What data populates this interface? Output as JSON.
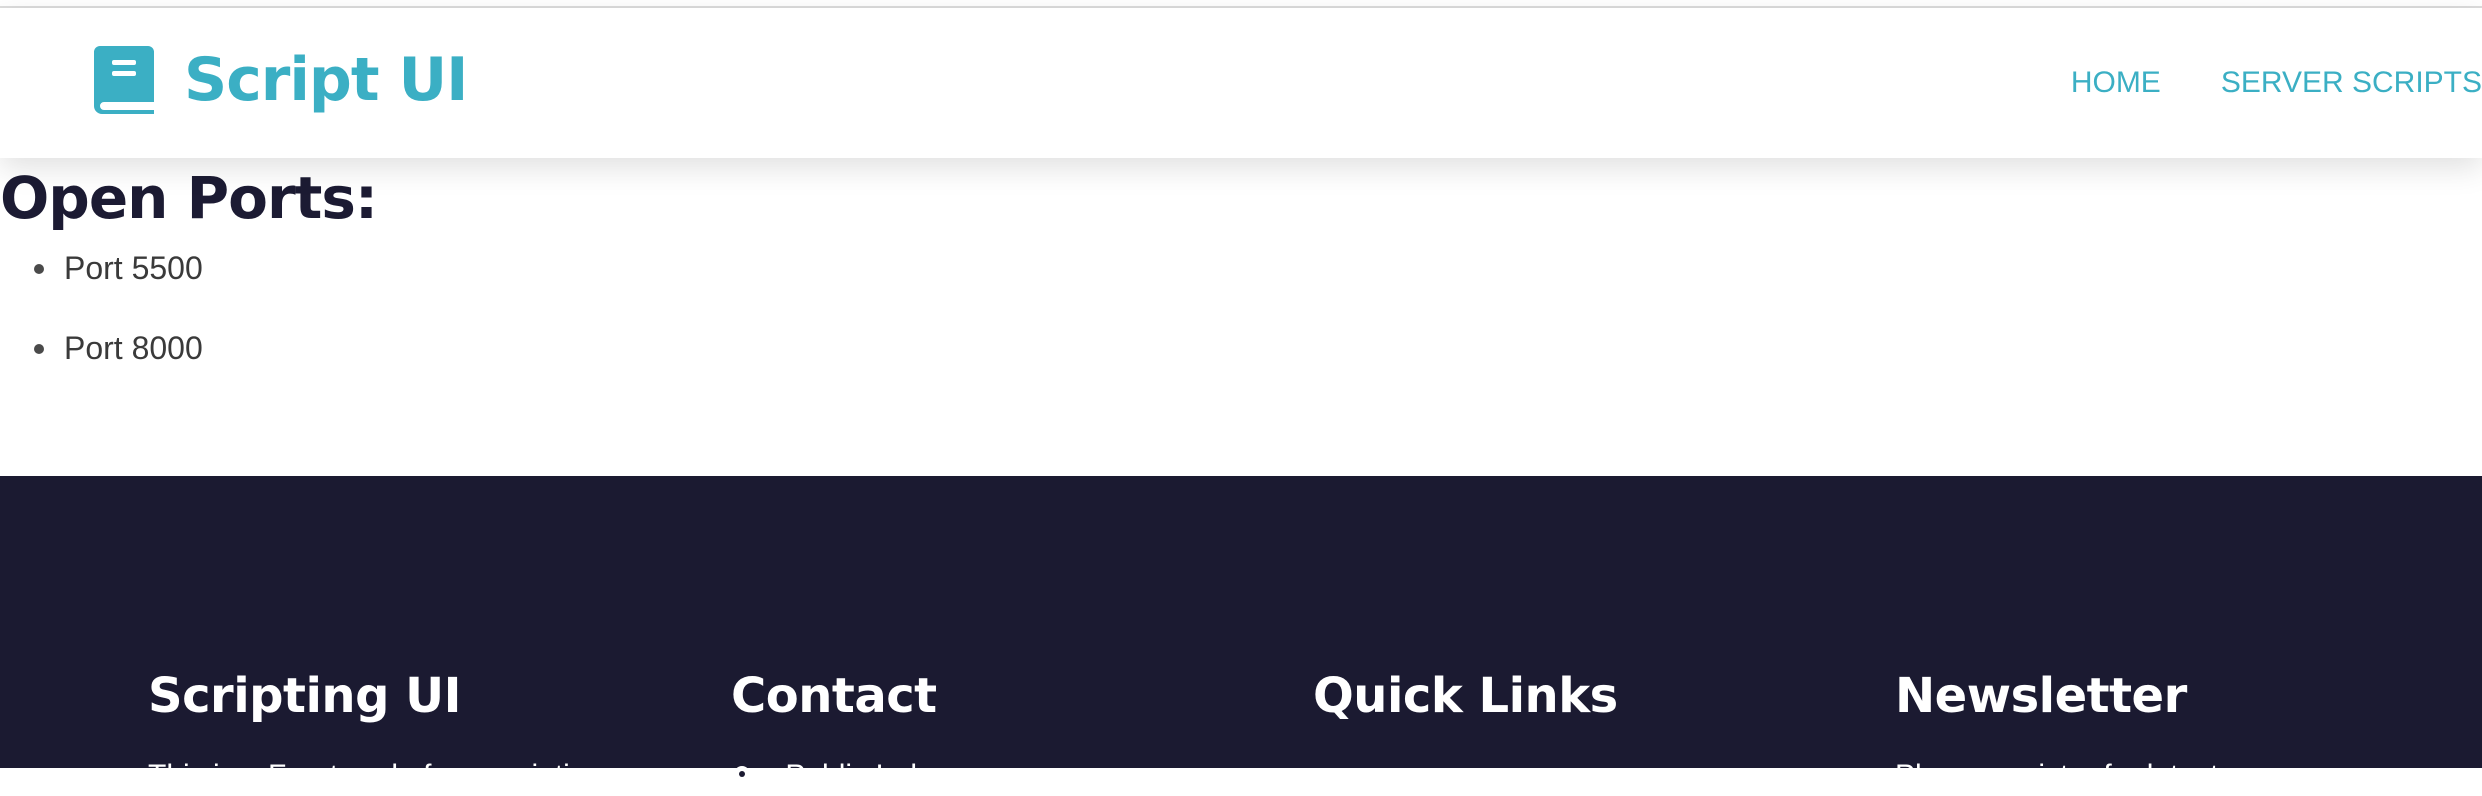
{
  "brand": {
    "name": "Script UI",
    "icon": "book-icon",
    "color": "#3bafc4"
  },
  "nav": {
    "links": [
      "HOME",
      "SERVER SCRIPTS"
    ]
  },
  "main": {
    "heading": "Open Ports:",
    "ports": [
      "Port 5500",
      "Port 8000"
    ]
  },
  "footer": {
    "background": "#1b1a31",
    "columns": [
      {
        "title": "Scripting UI",
        "text": "This is a Front-end of our scripti"
      },
      {
        "title": "Contact",
        "text": "Public Index...",
        "icon": "location-pin-icon"
      },
      {
        "title": "Quick Links",
        "text": ""
      },
      {
        "title": "Newsletter",
        "text": "Please register for latest"
      }
    ]
  }
}
